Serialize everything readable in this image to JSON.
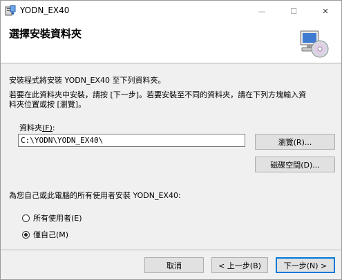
{
  "window": {
    "title": "YODN_EX40",
    "minimize_glyph": "—",
    "maximize_glyph": "☐",
    "close_glyph": "✕"
  },
  "banner": {
    "title": "選擇安裝資料夾",
    "icon": "computer-disc-icon"
  },
  "body": {
    "line1": "安裝程式將安裝 YODN_EX40 至下列資料夾。",
    "line2": "若要在此資料夾中安裝，請按 [下一步]。若要安裝至不同的資料夾，請在下列方塊輸入資",
    "line3": "料夾位置或按 [瀏覽]。"
  },
  "folder": {
    "label_text": "資料夾",
    "label_key": "(F)",
    "label_colon": ":",
    "value": "C:\\YODN\\YODN_EX40\\"
  },
  "buttons": {
    "browse": "瀏覽(R)...",
    "disk_cost": "磁碟空間(D)...",
    "cancel": "取消",
    "back": "< 上一步(B)",
    "next": "下一步(N) >"
  },
  "install_for": {
    "prompt": "為您自己或此電腦的所有使用者安裝 YODN_EX40:",
    "options": [
      {
        "label": "所有使用者(E)",
        "selected": false
      },
      {
        "label": "僅自己(M)",
        "selected": true
      }
    ]
  }
}
